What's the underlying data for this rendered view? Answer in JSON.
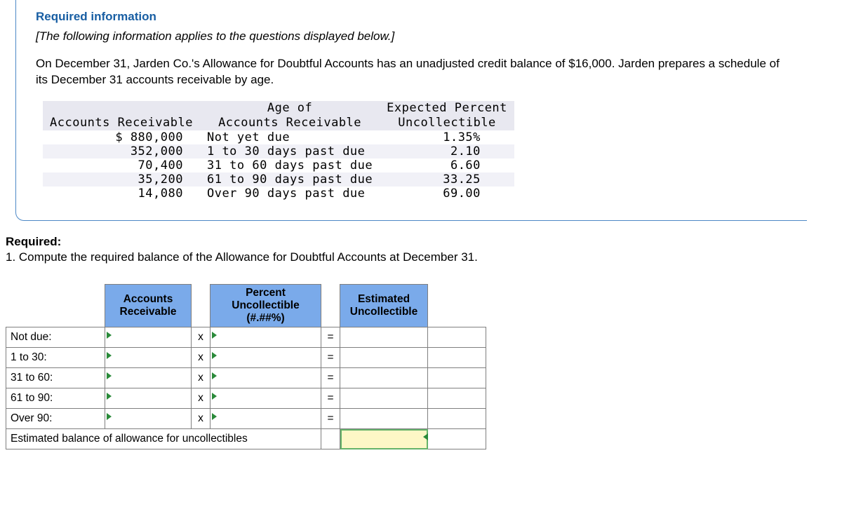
{
  "header": {
    "required_info": "Required information",
    "applies_note": "[The following information applies to the questions displayed below.]",
    "paragraph": "On December 31, Jarden Co.'s Allowance for Doubtful Accounts has an unadjusted credit balance of $16,000. Jarden prepares a schedule of its December 31 accounts receivable by age."
  },
  "schedule": {
    "col1": "Accounts Receivable",
    "col2a": "Age of",
    "col2b": "Accounts Receivable",
    "col3a": "Expected Percent",
    "col3b": "Uncollectible",
    "rows": [
      {
        "ar": "$ 880,000",
        "age": "Not yet due",
        "pct": "1.35%"
      },
      {
        "ar": "352,000",
        "age": "1 to 30 days past due",
        "pct": "2.10"
      },
      {
        "ar": "70,400",
        "age": "31 to 60 days past due",
        "pct": "6.60"
      },
      {
        "ar": "35,200",
        "age": "61 to 90 days past due",
        "pct": "33.25"
      },
      {
        "ar": "14,080",
        "age": "Over 90 days past due",
        "pct": "69.00"
      }
    ]
  },
  "required": {
    "label": "Required:",
    "q1": "1. Compute the required balance of the Allowance for Doubtful Accounts at December 31."
  },
  "worksheet": {
    "headers": {
      "acc": "Accounts Receivable",
      "pct": "Percent Uncollectible (#.##%)",
      "est": "Estimated Uncollectible"
    },
    "rows": [
      {
        "label": "Not due:",
        "op": "x",
        "eq": "="
      },
      {
        "label": "1 to 30:",
        "op": "x",
        "eq": "="
      },
      {
        "label": "31 to 60:",
        "op": "x",
        "eq": "="
      },
      {
        "label": "61 to 90:",
        "op": "x",
        "eq": "="
      },
      {
        "label": "Over 90:",
        "op": "x",
        "eq": "="
      }
    ],
    "total_label": "Estimated balance of allowance for uncollectibles"
  }
}
